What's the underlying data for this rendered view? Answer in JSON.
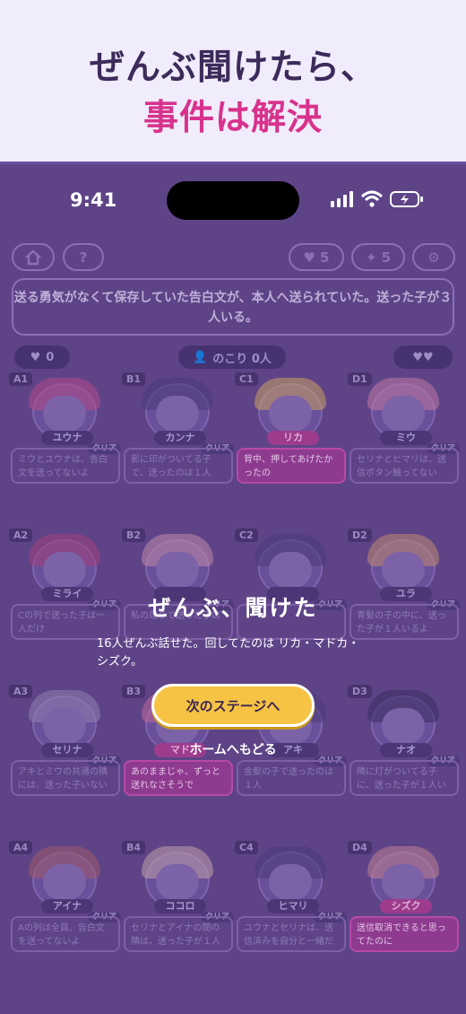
{
  "hero": {
    "line1": "ぜんぶ聞けたら、",
    "line2": "事件は解決"
  },
  "status": {
    "time": "9:41"
  },
  "topbar": {
    "hearts": "5",
    "stars": "5"
  },
  "prompt": "送る勇気がなくて保存していた告白文が、本人へ送られていた。送った子が３人いる。",
  "counters": {
    "hearts_count": "0",
    "remaining": "のこり 0人"
  },
  "cells": [
    {
      "id": "A1",
      "name": "ユウナ",
      "clear": "クリア",
      "text": "ミウとユウナは、告白文を送ってないよ",
      "hl": false,
      "nhl": false
    },
    {
      "id": "B1",
      "name": "カンナ",
      "clear": "クリア",
      "text": "影に印がついてる子で、送ったのは１人",
      "hl": false,
      "nhl": false
    },
    {
      "id": "C1",
      "name": "リカ",
      "clear": "",
      "text": "背中、押してあげたかったの",
      "hl": true,
      "nhl": true
    },
    {
      "id": "D1",
      "name": "ミウ",
      "clear": "クリア",
      "text": "セリナとヒマリは、送信ボタン触ってない",
      "hl": false,
      "nhl": false
    },
    {
      "id": "A2",
      "name": "ミライ",
      "clear": "クリア",
      "text": "Cの列で送った子は一人だけ",
      "hl": false,
      "nhl": false
    },
    {
      "id": "B2",
      "name": "",
      "clear": "クリア",
      "text": "私の周りで送った子は",
      "hl": false,
      "nhl": false
    },
    {
      "id": "C2",
      "name": "",
      "clear": "クリア",
      "text": "",
      "hl": false,
      "nhl": false
    },
    {
      "id": "D2",
      "name": "ユラ",
      "clear": "クリア",
      "text": "青髪の子の中に、送った子が１人いるよ",
      "hl": false,
      "nhl": false
    },
    {
      "id": "A3",
      "name": "セリナ",
      "clear": "クリア",
      "text": "アキとミウの共通の隣には、送った子いない",
      "hl": false,
      "nhl": false
    },
    {
      "id": "B3",
      "name": "マド",
      "clear": "",
      "text": "あのままじゃ、ずっと送れなさそうで",
      "hl": true,
      "nhl": true
    },
    {
      "id": "C3",
      "name": "アキ",
      "clear": "クリア",
      "text": "金髪の子で送ったのは１人",
      "hl": false,
      "nhl": false
    },
    {
      "id": "D3",
      "name": "ナオ",
      "clear": "クリア",
      "text": "隣に灯がついてる子に、送った子が１人いる",
      "hl": false,
      "nhl": false
    },
    {
      "id": "A4",
      "name": "アイナ",
      "clear": "クリア",
      "text": "Aの列は全員、告白文を送ってないよ",
      "hl": false,
      "nhl": false
    },
    {
      "id": "B4",
      "name": "ココロ",
      "clear": "クリア",
      "text": "セリナとアイナの間の隣は、送った子が１人いる",
      "hl": false,
      "nhl": false
    },
    {
      "id": "C4",
      "name": "ヒマリ",
      "clear": "クリア",
      "text": "ユウナとセリナは、送信済みを自分と一緒だった",
      "hl": false,
      "nhl": false
    },
    {
      "id": "D4",
      "name": "シズク",
      "clear": "",
      "text": "送信取消できると思ってたのに",
      "hl": true,
      "nhl": true
    }
  ],
  "overlay": {
    "title": "ぜんぶ、聞けた",
    "message": "16人ぜんぶ話せた。回してたのは リカ・マドカ・シズク。",
    "next": "次のステージへ",
    "home": "ホームへもどる"
  },
  "colors": {
    "accent": "#d8328c",
    "button": "#f6c344",
    "backdrop": "#5e4487"
  }
}
